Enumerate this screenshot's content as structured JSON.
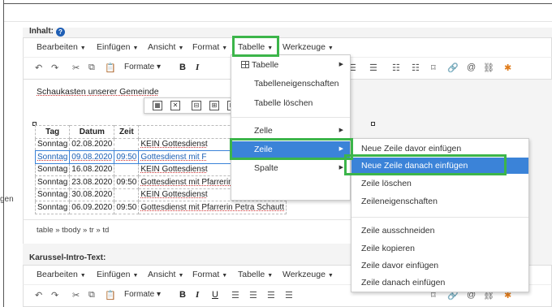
{
  "section1": {
    "label": "Inhalt:",
    "help": "?"
  },
  "menubar1": {
    "items": [
      "Bearbeiten",
      "Einfügen",
      "Ansicht",
      "Format",
      "Tabelle",
      "Werkzeuge"
    ]
  },
  "toolbar1": {
    "formats_label": "Formate"
  },
  "editor": {
    "title": "Schaukasten unserer Gemeinde",
    "headers": [
      "Tag",
      "Datum",
      "Zeit",
      "W"
    ],
    "rows": [
      [
        "Sonntag",
        "02.08.2020",
        "",
        "KEIN Gottesdienst"
      ],
      [
        "Sonntag",
        "09.08.2020",
        "09:50",
        "Gottesdienst mit F"
      ],
      [
        "Sonntag",
        "16.08.2020",
        "",
        "KEIN Gottesdienst"
      ],
      [
        "Sonntag",
        "23.08.2020",
        "09:50",
        "Gottesdienst mit Pfarrerin Petra Schautt"
      ],
      [
        "Sonntag",
        "30.08.2020",
        "",
        "KEIN Gottesdienst"
      ],
      [
        "Sonntag",
        "06.09.2020",
        "09:50",
        "Gottesdienst mit Pfarrerin Petra Schautt"
      ]
    ],
    "side_text": "gen"
  },
  "statusbar": {
    "path": "table » tbody » tr » td"
  },
  "table_menu": {
    "items": [
      "Tabelle",
      "Tabelleneigenschaften",
      "Tabelle löschen",
      "Zelle",
      "Zeile",
      "Spalte"
    ]
  },
  "row_submenu": {
    "items": [
      "Neue Zeile davor einfügen",
      "Neue Zeile danach einfügen",
      "Zeile löschen",
      "Zeileneigenschaften",
      "Zeile ausschneiden",
      "Zeile kopieren",
      "Zeile davor einfügen",
      "Zeile danach einfügen"
    ]
  },
  "section2": {
    "label": "Karussel-Intro-Text:"
  },
  "menubar2": {
    "items": [
      "Bearbeiten",
      "Einfügen",
      "Ansicht",
      "Format",
      "Tabelle",
      "Werkzeuge"
    ]
  },
  "toolbar2": {
    "formats_label": "Formate"
  },
  "colors": {
    "highlight": "#3cb54a",
    "active": "#3b83d8"
  }
}
